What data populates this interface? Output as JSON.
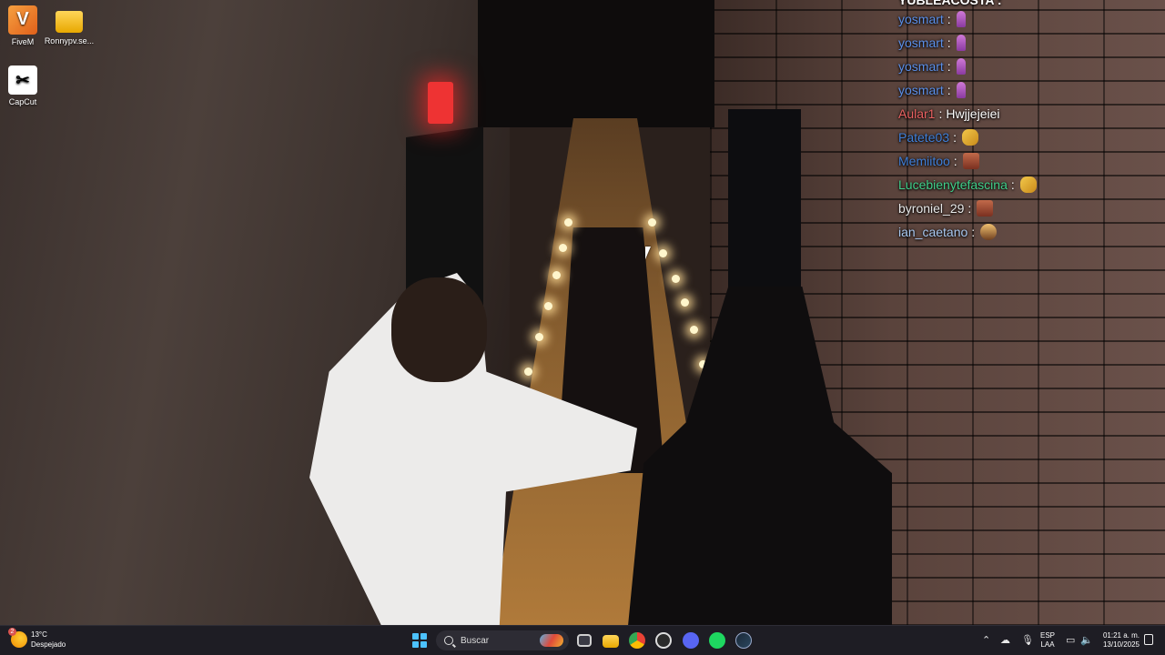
{
  "desktop": {
    "icons": [
      {
        "label": "FiveM",
        "icon": "fivem-icon"
      },
      {
        "label": "Ronnypv.se...",
        "icon": "folder-icon"
      },
      {
        "label": "CapCut",
        "icon": "capcut-icon"
      }
    ]
  },
  "chat": {
    "top_partial": "YUBLEACOSTA :",
    "messages": [
      {
        "user": "yosmart",
        "sep": ":",
        "text": "",
        "color": "#5b8fe8",
        "emote": "figure-emote"
      },
      {
        "user": "yosmart",
        "sep": ":",
        "text": "",
        "color": "#5b8fe8",
        "emote": "figure-emote"
      },
      {
        "user": "yosmart",
        "sep": ":",
        "text": "",
        "color": "#5b8fe8",
        "emote": "figure-emote"
      },
      {
        "user": "yosmart",
        "sep": ":",
        "text": "",
        "color": "#5b8fe8",
        "emote": "figure-emote"
      },
      {
        "user": "Aular1",
        "sep": ":",
        "text": "Hwjjejeiei",
        "color": "#e86060",
        "emote": ""
      },
      {
        "user": "Patete03",
        "sep": ":",
        "text": "",
        "color": "#3f7fd8",
        "emote": "praying-hands-emote"
      },
      {
        "user": "Memiitoo",
        "sep": ":",
        "text": "",
        "color": "#3f7fd8",
        "emote": "face-emote"
      },
      {
        "user": "Lucebienytefascina",
        "sep": ":",
        "text": "",
        "color": "#3fcf8a",
        "emote": "praying-hands-emote"
      },
      {
        "user": "byroniel_29",
        "sep": ":",
        "text": "",
        "color": "#e8e8e8",
        "emote": "face-emote"
      },
      {
        "user": "ian_caetano",
        "sep": ":",
        "text": "",
        "color": "#a8c8f0",
        "emote": "picture-emote"
      }
    ]
  },
  "taskbar": {
    "weather": {
      "temp": "13°C",
      "condition": "Despejado",
      "badge": "2"
    },
    "search_placeholder": "Buscar",
    "apps": [
      "task-view-icon",
      "file-explorer-icon",
      "chrome-icon",
      "github-icon",
      "discord-icon",
      "spotify-icon",
      "steam-icon"
    ],
    "language": {
      "line1": "ESP",
      "line2": "LAA"
    },
    "clock": {
      "time": "01:21 a. m.",
      "date": "13/10/2025"
    }
  }
}
